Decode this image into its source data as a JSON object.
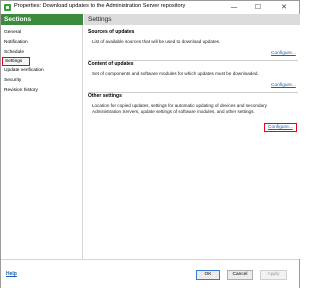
{
  "window": {
    "title": "Properties: Download updates to the Administration Server repository",
    "minimize_glyph": "—",
    "maximize_glyph": "☐",
    "close_glyph": "✕"
  },
  "sidebar": {
    "header": "Sections",
    "items": [
      {
        "label": "General"
      },
      {
        "label": "Notification"
      },
      {
        "label": "Schedule"
      },
      {
        "label": "Settings"
      },
      {
        "label": "Update verification"
      },
      {
        "label": "Security"
      },
      {
        "label": "Revision history"
      }
    ],
    "selected": "Settings"
  },
  "main": {
    "header": "Settings",
    "sections": [
      {
        "title": "Sources of updates",
        "description": "List of available sources that will be used to download updates.",
        "link": "Configure..."
      },
      {
        "title": "Content of updates",
        "description": "Set of components and software modules for which updates must be downloaded.",
        "link": "Configure..."
      },
      {
        "title": "Other settings",
        "description": "Location for copied updates, settings for automatic updating of devices and secondary Administration Servers, update settings of software modules, and other settings.",
        "link": "Configure..."
      }
    ]
  },
  "footer": {
    "help": "Help",
    "ok": "OK",
    "cancel": "Cancel",
    "apply": "Apply"
  },
  "colors": {
    "accent_green": "#3a8c3c",
    "highlight_red": "#e8001c",
    "link_blue": "#1a5fb4"
  }
}
